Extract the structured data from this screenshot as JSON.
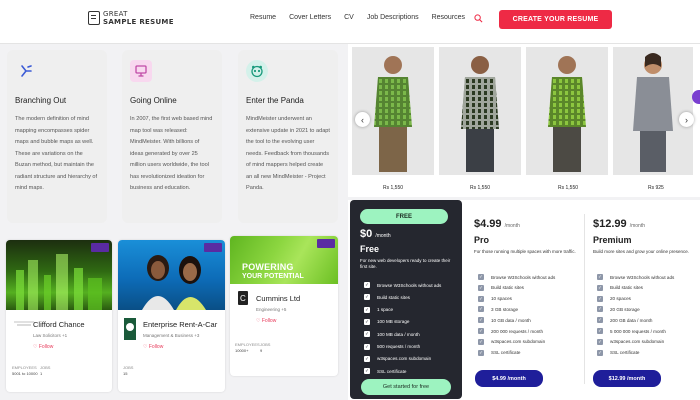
{
  "header": {
    "logo_line1": "GREAT",
    "logo_line2": "SAMPLE RESUME",
    "nav": [
      "Resume",
      "Cover Letters",
      "CV",
      "Job Descriptions",
      "Resources"
    ],
    "cta_label": "CREATE YOUR RESUME",
    "accent": "#ee2a45"
  },
  "ideas": [
    {
      "icon": "branching-icon",
      "title": "Branching Out",
      "body": "The modern definition of mind mapping encompasses spider maps and bubble maps as well. These are variations on the Buzan method, but maintain the radiant structure and hierarchy of mind maps."
    },
    {
      "icon": "monitor-icon",
      "title": "Going Online",
      "body": "In 2007, the first web based mind map tool was released: MindMeister. With billions of ideas generated by over 25 million users worldwide, the tool has revolutionized ideation for business and education."
    },
    {
      "icon": "panda-icon",
      "title": "Enter the Panda",
      "body": "MindMeister underwent an extensive update in 2021 to adapt the tool to the evolving user needs. Feedback from thousands of mind mappers helped create an all new MindMeister - Project Panda."
    }
  ],
  "companies": [
    {
      "name": "Clifford Chance",
      "industry": "Law Solicitors +1",
      "follow": "Follow",
      "employees_label": "EMPLOYEES",
      "employees": "5001 to 10000",
      "jobs_label": "JOBS",
      "jobs": "1"
    },
    {
      "name": "Enterprise Rent-A-Car",
      "industry": "Management & Business +3",
      "follow": "Follow",
      "jobs_label": "JOBS",
      "jobs": "15"
    },
    {
      "name": "Cummins Ltd",
      "industry": "Engineering +5",
      "follow": "Follow",
      "image_text_1": "POWERING",
      "image_text_2": "YOUR POTENTIAL",
      "employees_label": "EMPLOYEES",
      "employees": "10000+",
      "jobs_label": "JOBS",
      "jobs": "9"
    }
  ],
  "carousel": {
    "prices": [
      "Rs 1,550",
      "Rs 1,550",
      "Rs 1,550",
      "Rs 925"
    ],
    "prev": "‹",
    "next": "›"
  },
  "pricing": {
    "free": {
      "tag": "FREE",
      "price": "$0",
      "per": "/month",
      "name": "Free",
      "desc": "For new web developers ready to create their first site.",
      "features": [
        "Browse W3Schools without ads",
        "Build static sites",
        "1 space",
        "100 MB storage",
        "100 MB data / month",
        "500 requests / month",
        "w3spaces.com subdomain",
        "SSL certificate"
      ],
      "button": "Get started for free"
    },
    "pro": {
      "price": "$4.99",
      "per": "/month",
      "name": "Pro",
      "desc": "For those running multiple spaces with more traffic.",
      "features": [
        "Browse W3Schools without ads",
        "Build static sites",
        "10 spaces",
        "3 GB storage",
        "10 GB data / month",
        "200 000 requests / month",
        "w3spaces.com subdomain",
        "SSL certificate"
      ],
      "button": "$4.99 /month"
    },
    "premium": {
      "price": "$12.99",
      "per": "/month",
      "name": "Premium",
      "desc": "Build more sites and grow your online presence.",
      "features": [
        "Browse W3Schools without ads",
        "Build static sites",
        "20 spaces",
        "20 GB storage",
        "200 GB data / month",
        "5 000 000 requests / month",
        "w3spaces.com subdomain",
        "SSL certificate"
      ],
      "button": "$12.99 /month"
    },
    "colors": {
      "free_bg": "#25272f",
      "free_accent": "#9df3c0",
      "pay_button": "#1f1e9a"
    }
  }
}
